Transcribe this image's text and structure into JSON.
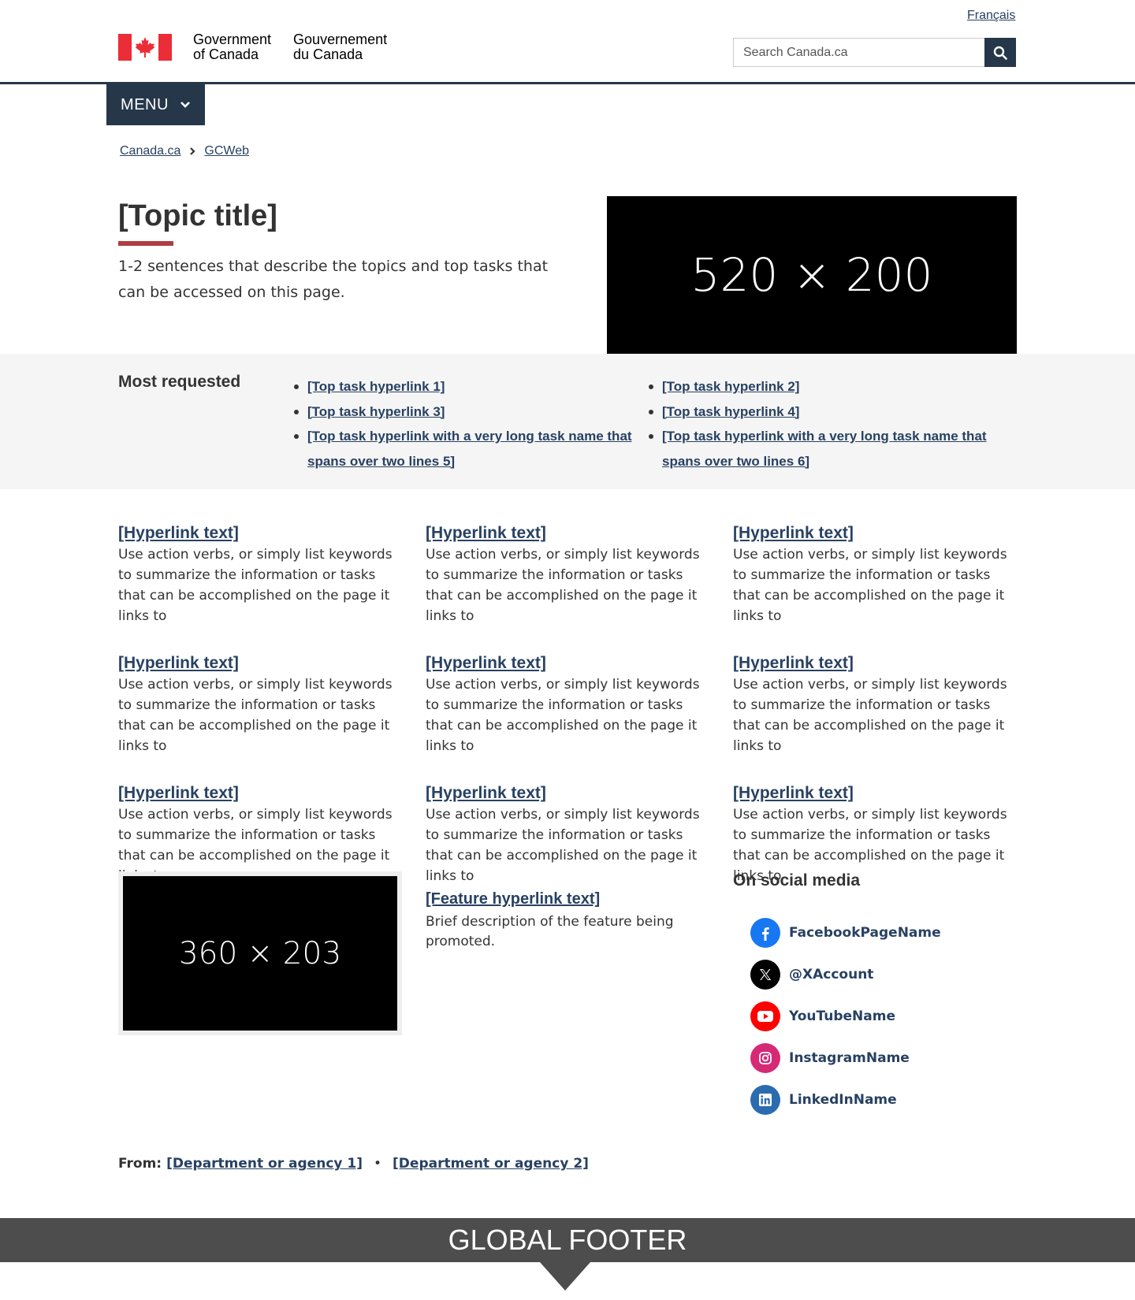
{
  "header": {
    "language_link": "Français",
    "brand_en_line1": "Government",
    "brand_en_line2": "of Canada",
    "brand_fr_line1": "Gouvernement",
    "brand_fr_line2": "du Canada",
    "search_placeholder": "Search Canada.ca",
    "menu_label": "MENU"
  },
  "breadcrumb": [
    "Canada.ca",
    "GCWeb"
  ],
  "hero": {
    "title": "[Topic title]",
    "lead": "1-2 sentences that describe the topics and top tasks that can be accessed on this page.",
    "image_label": "520 × 200"
  },
  "most_requested": {
    "heading": "Most requested",
    "col1": [
      "[Top task hyperlink 1]",
      "[Top task hyperlink 3]",
      "[Top task hyperlink with a very long task name that spans over two lines 5]"
    ],
    "col2": [
      "[Top task hyperlink 2]",
      "[Top task hyperlink 4]",
      "[Top task hyperlink with a very long task name that spans over two lines 6]"
    ]
  },
  "cards": [
    {
      "link": "[Hyperlink text]",
      "desc": "Use action verbs, or simply list keywords to summarize the information or tasks that can be accomplished on the page it links to"
    },
    {
      "link": "[Hyperlink text]",
      "desc": "Use action verbs, or simply list keywords to summarize the information or tasks that can be accomplished on the page it links to"
    },
    {
      "link": "[Hyperlink text]",
      "desc": "Use action verbs, or simply list keywords to summarize the information or tasks that can be accomplished on the page it links to"
    },
    {
      "link": "[Hyperlink text]",
      "desc": "Use action verbs, or simply list keywords to summarize the information or tasks that can be accomplished on the page it links to"
    },
    {
      "link": "[Hyperlink text]",
      "desc": "Use action verbs, or simply list keywords to summarize the information or tasks that can be accomplished on the page it links to"
    },
    {
      "link": "[Hyperlink text]",
      "desc": "Use action verbs, or simply list keywords to summarize the information or tasks that can be accomplished on the page it links to"
    },
    {
      "link": "[Hyperlink text]",
      "desc": "Use action verbs, or simply list keywords to summarize the information or tasks that can be accomplished on the page it links to"
    },
    {
      "link": "[Hyperlink text]",
      "desc": "Use action verbs, or simply list keywords to summarize the information or tasks that can be accomplished on the page it links to"
    },
    {
      "link": "[Hyperlink text]",
      "desc": "Use action verbs, or simply list keywords to summarize the information or tasks that can be accomplished on the page it links to"
    }
  ],
  "feature": {
    "image_label": "360 × 203",
    "link": "[Feature hyperlink text]",
    "desc": "Brief description of the feature being promoted."
  },
  "social": {
    "heading": "On social media",
    "items": [
      {
        "label": "FacebookPageName",
        "icon": "facebook-icon",
        "color": "#1877f2"
      },
      {
        "label": "@XAccount",
        "icon": "x-icon",
        "color": "#000000"
      },
      {
        "label": "YouTubeName",
        "icon": "youtube-icon",
        "color": "#ff0000"
      },
      {
        "label": "InstagramName",
        "icon": "instagram-icon",
        "color": "#d62976"
      },
      {
        "label": "LinkedInName",
        "icon": "linkedin-icon",
        "color": "#2b6cb0"
      }
    ]
  },
  "from": {
    "label": "From:",
    "dept1": "[Department or agency 1]",
    "dept2": "[Department or agency 2]"
  },
  "footer": {
    "label": "GLOBAL FOOTER"
  },
  "colors": {
    "link": "#284162",
    "header_dark": "#26374a",
    "accent_red": "#af3c43",
    "flag_red": "#eb2d37",
    "band_gray": "#f5f5f5",
    "footer_gray": "#4d4d4d"
  }
}
